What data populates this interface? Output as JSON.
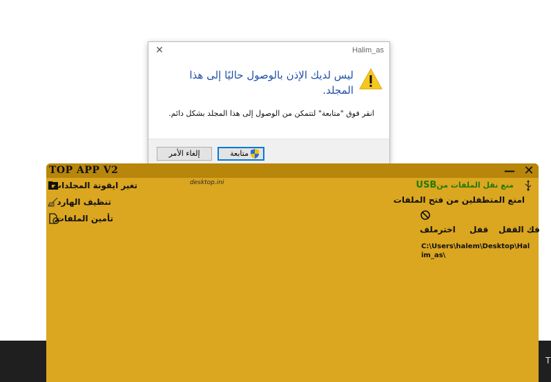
{
  "dialog": {
    "title": "Halim_as",
    "close_glyph": "✕",
    "heading": "ليس لديك الإذن بالوصول حاليًا إلى هذا المجلد.",
    "body": "انقر فوق \"متابعة\" لتتمكن من الوصول إلى هذا المجلد بشكل دائم.",
    "continue_label": "متابعة",
    "cancel_label": "إلغاء الأمر",
    "warning_icon": "warning-triangle-icon",
    "shield_icon": "uac-shield-icon"
  },
  "app": {
    "title": "TOP APP V2",
    "minimize_glyph": "—",
    "close_glyph": "✕",
    "desktop_ini_label": "desktop.ini",
    "menu": [
      {
        "label": "تغير ايقونة المجلدات",
        "icon": "folder-icon"
      },
      {
        "label": "تنظيف الهارد",
        "icon": "broom-icon"
      },
      {
        "label": "تأمين الملفات",
        "icon": "file-lock-icon"
      }
    ],
    "usb_label": "منع نقل الملفات من",
    "usb_suffix": "USB",
    "usb_icon": "usb-icon",
    "block_intruders_label": "امنع المتطفلين من فتح الملفات",
    "block_icon": "prohibited-icon",
    "actions": {
      "unlock": "فك القفل",
      "lock": "قفل",
      "password": "اخترملف"
    },
    "path": "C:\\Users\\halem\\Desktop\\Halim_as\\"
  },
  "colors": {
    "app_body": "#dba620",
    "app_titlebar": "#b8860b",
    "dialog_heading": "#1e4fa8",
    "usb_green": "#1f7a0a",
    "taskbar": "#1f1f1f"
  }
}
